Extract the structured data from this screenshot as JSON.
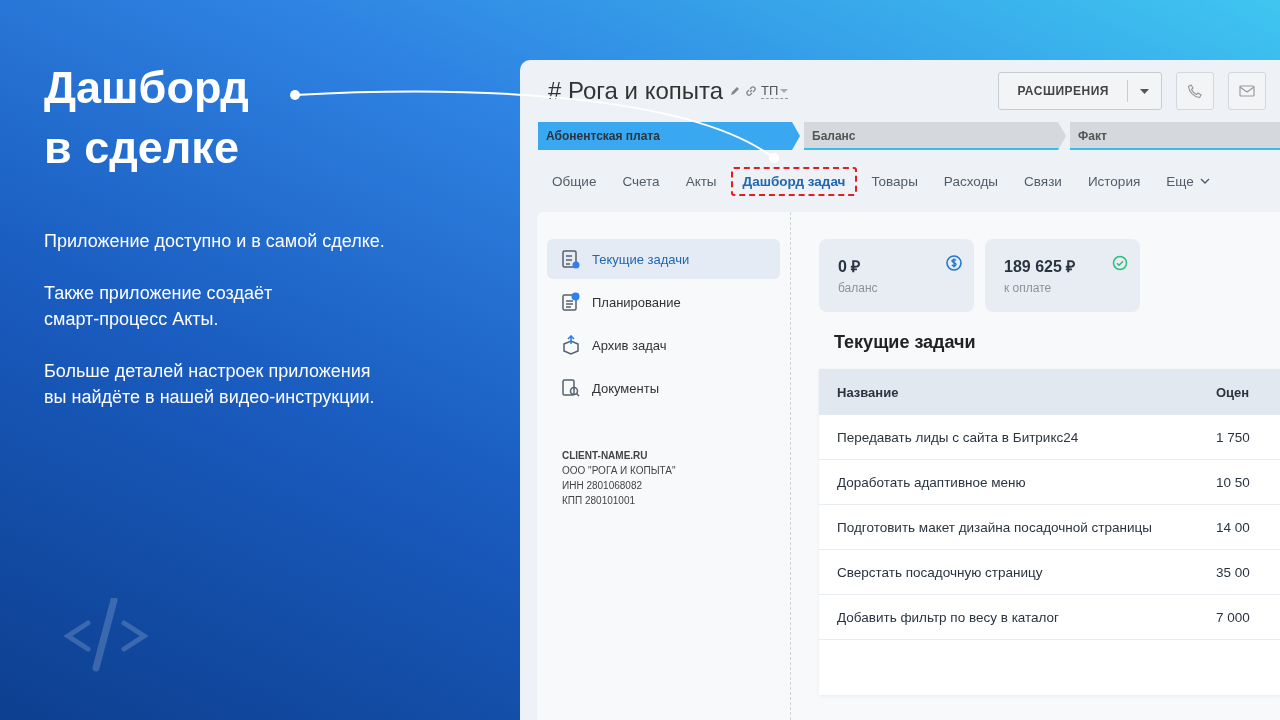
{
  "promo": {
    "title_lines": [
      "Дашборд",
      "в сделке"
    ],
    "paragraphs": [
      {
        "lines": [
          "Приложение доступно и в самой сделке."
        ]
      },
      {
        "lines": [
          "Также приложение создаёт",
          "смарт-процесс Акты."
        ]
      },
      {
        "lines": [
          "Больше деталей настроек приложения",
          "вы найдёте в нашей видео-инструкции."
        ]
      }
    ]
  },
  "deal": {
    "title": "# Рога и копыта",
    "category": "ТП",
    "buttons": {
      "extensions": "РАСШИРЕНИЯ"
    },
    "stages": [
      {
        "label": "Абонентская плата",
        "active": true
      },
      {
        "label": "Баланс",
        "active": false
      },
      {
        "label": "Факт",
        "active": false
      }
    ],
    "tabs": [
      {
        "label": "Общие",
        "selected": false
      },
      {
        "label": "Счета",
        "selected": false
      },
      {
        "label": "Акты",
        "selected": false
      },
      {
        "label": "Дашборд задач",
        "selected": true
      },
      {
        "label": "Товары",
        "selected": false
      },
      {
        "label": "Расходы",
        "selected": false
      },
      {
        "label": "Связи",
        "selected": false
      },
      {
        "label": "История",
        "selected": false
      },
      {
        "label": "Еще",
        "selected": false
      }
    ]
  },
  "sidebar": {
    "items": [
      {
        "label": "Текущие задачи",
        "kind": "tasks",
        "selected": true
      },
      {
        "label": "Планирование",
        "kind": "planning",
        "selected": false
      },
      {
        "label": "Архив задач",
        "kind": "archive",
        "selected": false
      },
      {
        "label": "Документы",
        "kind": "documents",
        "selected": false
      }
    ],
    "company": [
      "CLIENT-NAME.RU",
      "ООО \"РОГА И КОПЫТА\"",
      "ИНН 2801068082",
      "КПП 280101001"
    ]
  },
  "cards": [
    {
      "value": "0 ₽",
      "caption": "баланс",
      "kind": "balance"
    },
    {
      "value": "189 625 ₽",
      "caption": "к оплате",
      "kind": "paid"
    }
  ],
  "section_title": "Текущие задачи",
  "table": {
    "columns": [
      "Название",
      "Оцен"
    ],
    "rows": [
      [
        "Передавать лиды с сайта в Битрикс24",
        "1 750"
      ],
      [
        "Доработать адаптивное меню",
        "10 50"
      ],
      [
        "Подготовить макет дизайна посадочной страницы",
        "14 00"
      ],
      [
        "Сверстать посадочную страницу",
        "35 00"
      ],
      [
        "Добавить фильтр по весу в каталог",
        "7 000"
      ]
    ]
  }
}
